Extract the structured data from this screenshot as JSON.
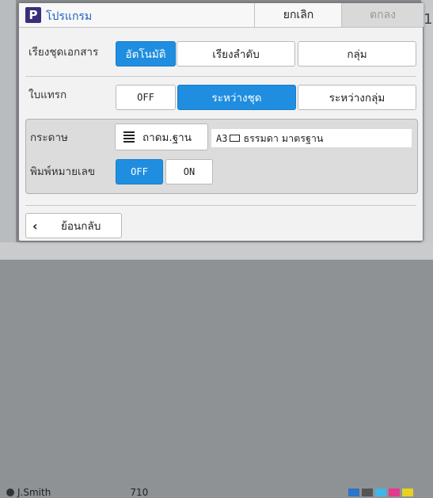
{
  "background": {
    "user": "J.Smith",
    "count": "710",
    "right_digit": "1"
  },
  "dialog": {
    "title": "โปรแกรม",
    "icon_letter": "P",
    "cancel_label": "ยกเลิก",
    "ok_label": "ตกลง"
  },
  "sorting": {
    "label": "เรียงชุดเอกสาร",
    "options": [
      "อัตโนมัติ",
      "เรียงลำดับ",
      "กลุ่ม"
    ],
    "selected": "อัตโนมัติ"
  },
  "insert": {
    "label": "ใบแทรก",
    "options": [
      "OFF",
      "ระหว่างชุด",
      "ระหว่างกลุ่ม"
    ],
    "selected": "ระหว่างชุด"
  },
  "paper": {
    "label": "กระดาษ",
    "tray_label": "ถาดม.ฐาน",
    "size": "A3",
    "type": "ธรรมดา มาตรฐาน"
  },
  "numbering": {
    "label": "พิมพ์หมายเลข",
    "options": [
      "OFF",
      "ON"
    ],
    "selected": "OFF"
  },
  "footer": {
    "back_label": "ย้อนกลับ"
  },
  "colors": {
    "accent": "#1f8ee0",
    "title": "#1f5fbf",
    "icon": "#3a2e7a"
  }
}
